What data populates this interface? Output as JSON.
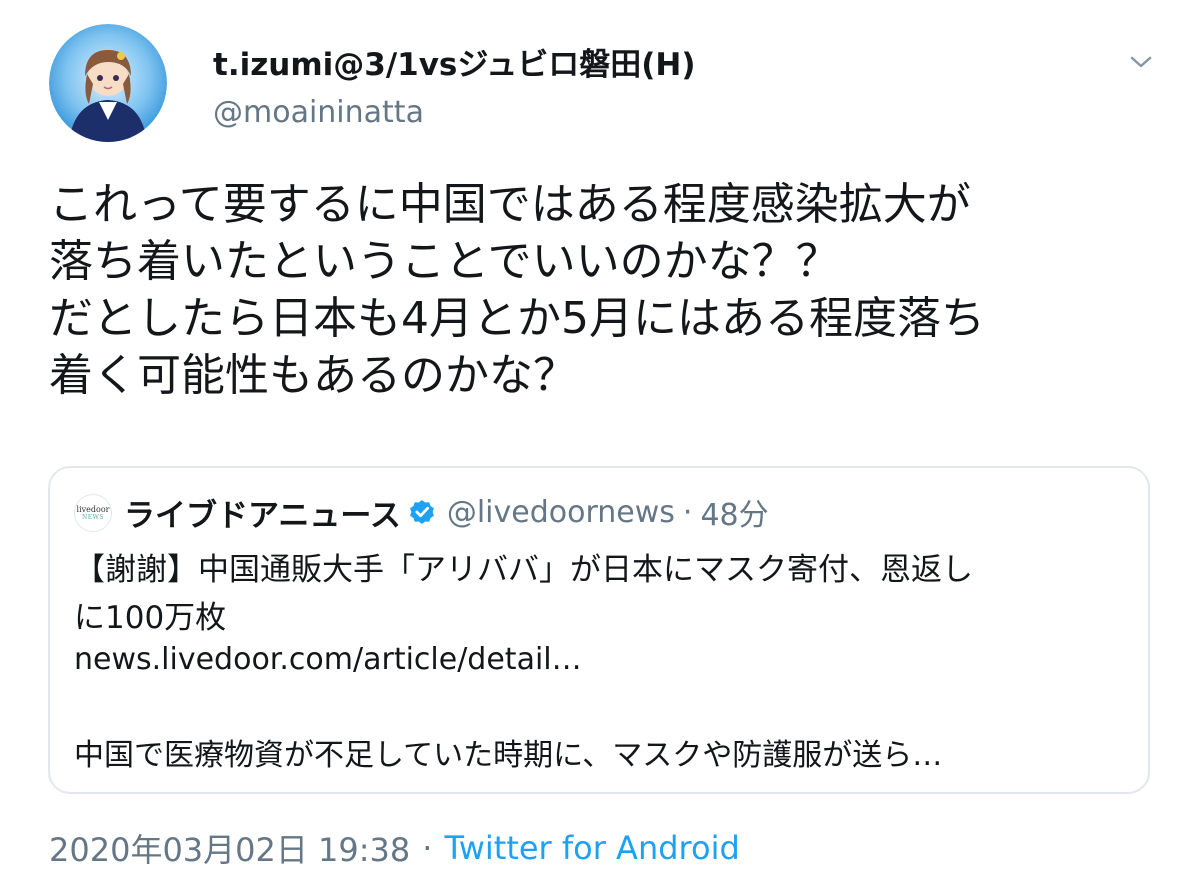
{
  "author": {
    "display_name": "t.izumi@3/1vsジュビロ磐田(H)",
    "handle": "@moaininatta",
    "avatar_icon": "anime-character-avatar"
  },
  "menu_icon": "chevron-down-icon",
  "tweet": {
    "lines": [
      "これって要するに中国ではある程度感染拡大が",
      "落ち着いたということでいいのかな？？",
      "だとしたら日本も4月とか5月にはある程度落ち",
      "着く可能性もあるのかな？"
    ]
  },
  "quote": {
    "avatar_text_1": "livedoor",
    "avatar_text_2": "NEWS",
    "name": "ライブドアニュース",
    "verified_icon": "verified-badge-icon",
    "handle": "@livedoornews",
    "separator": "·",
    "time": "48分",
    "body_lines": [
      "【謝謝】中国通販大手「アリババ」が日本にマスク寄付、恩返し",
      "に100万枚"
    ],
    "link": "news.livedoor.com/article/detail…",
    "summary": "中国で医療物資が不足していた時期に、マスクや防護服が送ら…"
  },
  "footer": {
    "timestamp": "2020年03月02日 19:38",
    "separator": "·",
    "source": "Twitter for Android"
  },
  "colors": {
    "text": "#14171a",
    "secondary": "#657786",
    "link": "#1da1f2",
    "border": "#e1e8ed"
  }
}
